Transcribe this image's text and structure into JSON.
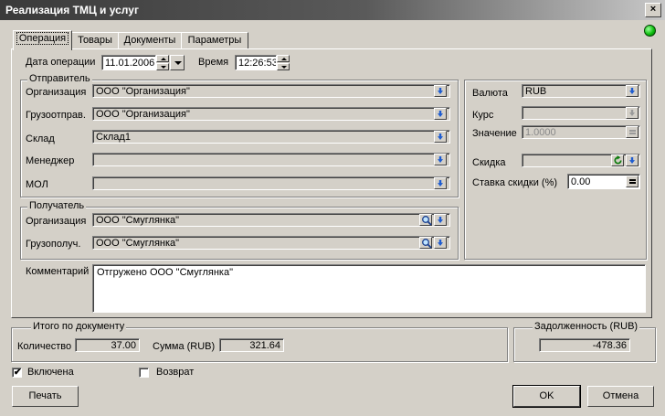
{
  "window": {
    "title": "Реализация ТМЦ и услуг",
    "close_label": "×"
  },
  "tabs": [
    {
      "label": "Операция"
    },
    {
      "label": "Товары"
    },
    {
      "label": "Документы"
    },
    {
      "label": "Параметры"
    }
  ],
  "operation": {
    "date_label": "Дата операции",
    "date_value": "11.01.2006",
    "time_label": "Время",
    "time_value": "12:26:53"
  },
  "sender": {
    "group_label": "Отправитель",
    "organization_label": "Организация",
    "organization_value": "ООО \"Организация\"",
    "shipper_label": "Грузоотправ.",
    "shipper_value": "ООО \"Организация\"",
    "warehouse_label": "Склад",
    "warehouse_value": "Склад1",
    "manager_label": "Менеджер",
    "manager_value": "",
    "mol_label": "МОЛ",
    "mol_value": ""
  },
  "receiver": {
    "group_label": "Получатель",
    "organization_label": "Организация",
    "organization_value": "ООО \"Смуглянка\"",
    "consignee_label": "Грузополуч.",
    "consignee_value": "ООО \"Смуглянка\""
  },
  "currency": {
    "currency_label": "Валюта",
    "currency_value": "RUB",
    "rate_label": "Курс",
    "rate_value": "",
    "value_label": "Значение",
    "value_value": "1.0000",
    "discount_label": "Скидка",
    "discount_value": "",
    "discount_rate_label": "Ставка скидки (%)",
    "discount_rate_value": "0.00"
  },
  "comment": {
    "label": "Комментарий",
    "value": "Отгружено ООО \"Смуглянка\""
  },
  "totals": {
    "group_label": "Итого по документу",
    "quantity_label": "Количество",
    "quantity_value": "37.00",
    "sum_label": "Сумма (RUB)",
    "sum_value": "321.64"
  },
  "debt": {
    "group_label": "Задолженность (RUB)",
    "value": "-478.36"
  },
  "checkboxes": {
    "enabled_label": "Включена",
    "enabled_checked": true,
    "return_label": "Возврат",
    "return_checked": false
  },
  "buttons": {
    "print_label": "Печать",
    "ok_label": "OK",
    "cancel_label": "Отмена"
  },
  "colors": {
    "status_led": "#10c010",
    "arrow_blue": "#1e5cd0"
  }
}
